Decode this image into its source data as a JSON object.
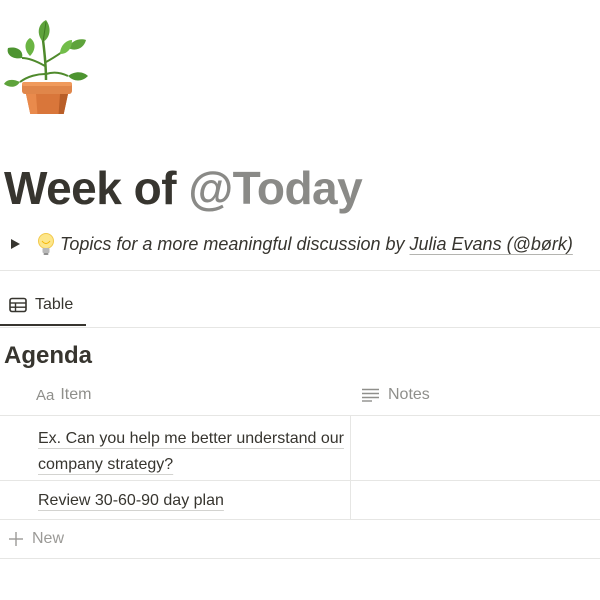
{
  "page": {
    "icon": "potted-plant-icon",
    "title_prefix": "Week of ",
    "title_mention": "@Today"
  },
  "toggle": {
    "icon": "light-bulb-icon",
    "text": "Topics for a more meaningful discussion by",
    "author_link": "Julia Evans (@børk)"
  },
  "view_tabs": [
    {
      "icon": "table-icon",
      "label": "Table"
    }
  ],
  "database": {
    "title": "Agenda",
    "columns": [
      {
        "icon": "text-aa-icon",
        "icon_text": "Aa",
        "label": "Item"
      },
      {
        "icon": "lines-icon",
        "label": "Notes"
      }
    ],
    "rows": [
      {
        "item": "Ex. Can you help me better understand our company strategy?",
        "notes": ""
      },
      {
        "item": "Review 30-60-90 day plan",
        "notes": ""
      }
    ],
    "new_label": "New"
  },
  "colors": {
    "text": "#37352f",
    "mention": "#8a8a87",
    "muted": "#9b9a97",
    "border": "#e6e6e4"
  }
}
